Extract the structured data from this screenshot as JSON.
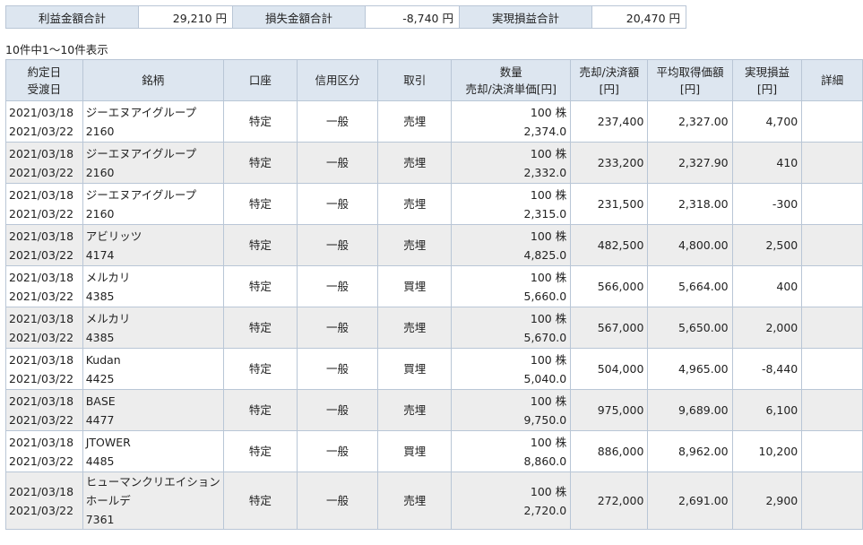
{
  "summary": {
    "profit_label": "利益金額合計",
    "profit_value": "29,210 円",
    "loss_label": "損失金額合計",
    "loss_value": "-8,740 円",
    "realized_label": "実現損益合計",
    "realized_value": "20,470 円"
  },
  "count_text": "10件中1～10件表示",
  "headers": {
    "date_top": "約定日",
    "date_bottom": "受渡日",
    "stock": "銘柄",
    "account": "口座",
    "credit": "信用区分",
    "trade": "取引",
    "qty_top": "数量",
    "qty_bottom": "売却/決済単価[円]",
    "amount_top": "売却/決済額",
    "amount_bottom": "[円]",
    "avg_top": "平均取得価額",
    "avg_bottom": "[円]",
    "pl_top": "実現損益",
    "pl_bottom": "[円]",
    "detail": "詳細"
  },
  "rows": [
    {
      "trade_date": "2021/03/18",
      "settle_date": "2021/03/22",
      "name": "ジーエヌアイグループ",
      "name2": "",
      "code": "2160",
      "account": "特定",
      "credit": "一般",
      "trade": "売埋",
      "qty": "100 株",
      "price": "2,374.0",
      "amount": "237,400",
      "avg": "2,327.00",
      "pl": "4,700",
      "detail": ""
    },
    {
      "trade_date": "2021/03/18",
      "settle_date": "2021/03/22",
      "name": "ジーエヌアイグループ",
      "name2": "",
      "code": "2160",
      "account": "特定",
      "credit": "一般",
      "trade": "売埋",
      "qty": "100 株",
      "price": "2,332.0",
      "amount": "233,200",
      "avg": "2,327.90",
      "pl": "410",
      "detail": ""
    },
    {
      "trade_date": "2021/03/18",
      "settle_date": "2021/03/22",
      "name": "ジーエヌアイグループ",
      "name2": "",
      "code": "2160",
      "account": "特定",
      "credit": "一般",
      "trade": "売埋",
      "qty": "100 株",
      "price": "2,315.0",
      "amount": "231,500",
      "avg": "2,318.00",
      "pl": "-300",
      "detail": ""
    },
    {
      "trade_date": "2021/03/18",
      "settle_date": "2021/03/22",
      "name": "アビリッツ",
      "name2": "",
      "code": "4174",
      "account": "特定",
      "credit": "一般",
      "trade": "売埋",
      "qty": "100 株",
      "price": "4,825.0",
      "amount": "482,500",
      "avg": "4,800.00",
      "pl": "2,500",
      "detail": ""
    },
    {
      "trade_date": "2021/03/18",
      "settle_date": "2021/03/22",
      "name": "メルカリ",
      "name2": "",
      "code": "4385",
      "account": "特定",
      "credit": "一般",
      "trade": "買埋",
      "qty": "100 株",
      "price": "5,660.0",
      "amount": "566,000",
      "avg": "5,664.00",
      "pl": "400",
      "detail": ""
    },
    {
      "trade_date": "2021/03/18",
      "settle_date": "2021/03/22",
      "name": "メルカリ",
      "name2": "",
      "code": "4385",
      "account": "特定",
      "credit": "一般",
      "trade": "売埋",
      "qty": "100 株",
      "price": "5,670.0",
      "amount": "567,000",
      "avg": "5,650.00",
      "pl": "2,000",
      "detail": ""
    },
    {
      "trade_date": "2021/03/18",
      "settle_date": "2021/03/22",
      "name": "Kudan",
      "name2": "",
      "code": "4425",
      "account": "特定",
      "credit": "一般",
      "trade": "買埋",
      "qty": "100 株",
      "price": "5,040.0",
      "amount": "504,000",
      "avg": "4,965.00",
      "pl": "-8,440",
      "detail": ""
    },
    {
      "trade_date": "2021/03/18",
      "settle_date": "2021/03/22",
      "name": "BASE",
      "name2": "",
      "code": "4477",
      "account": "特定",
      "credit": "一般",
      "trade": "売埋",
      "qty": "100 株",
      "price": "9,750.0",
      "amount": "975,000",
      "avg": "9,689.00",
      "pl": "6,100",
      "detail": ""
    },
    {
      "trade_date": "2021/03/18",
      "settle_date": "2021/03/22",
      "name": "JTOWER",
      "name2": "",
      "code": "4485",
      "account": "特定",
      "credit": "一般",
      "trade": "買埋",
      "qty": "100 株",
      "price": "8,860.0",
      "amount": "886,000",
      "avg": "8,962.00",
      "pl": "10,200",
      "detail": ""
    },
    {
      "trade_date": "2021/03/18",
      "settle_date": "2021/03/22",
      "name": "ヒューマンクリエイション",
      "name2": "ホールデ",
      "code": "7361",
      "account": "特定",
      "credit": "一般",
      "trade": "売埋",
      "qty": "100 株",
      "price": "2,720.0",
      "amount": "272,000",
      "avg": "2,691.00",
      "pl": "2,900",
      "detail": ""
    }
  ]
}
